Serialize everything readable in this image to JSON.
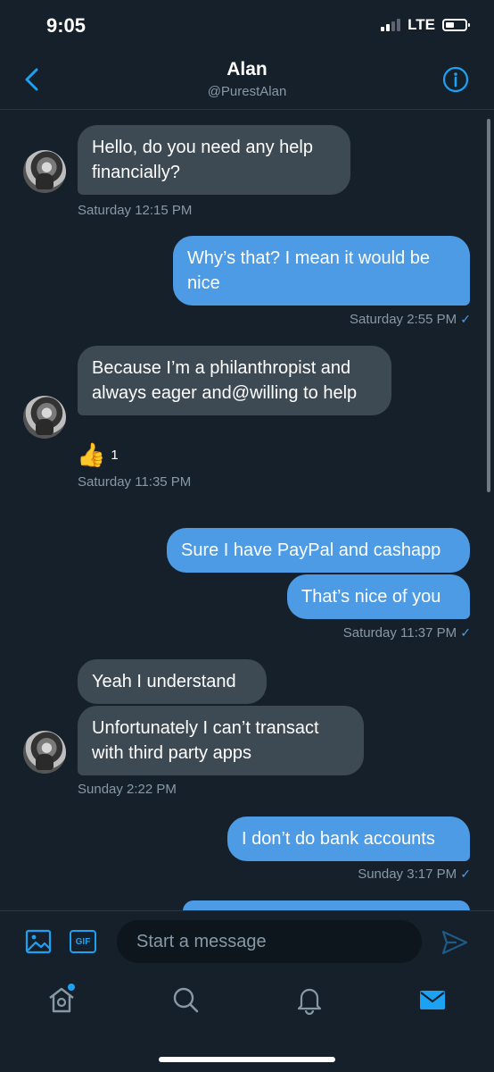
{
  "status_bar": {
    "time": "9:05",
    "network": "LTE"
  },
  "header": {
    "name": "Alan",
    "handle": "@PurestAlan"
  },
  "messages": {
    "m1": {
      "text": "Hello, do you need any help financially?",
      "time": "Saturday 12:15 PM"
    },
    "m2": {
      "text": "Why’s that? I mean it would be nice",
      "time": "Saturday 2:55 PM"
    },
    "m3": {
      "text": "Because I’m a philanthropist and always eager and@willing to help",
      "reaction_count": "1",
      "time": "Saturday 11:35 PM"
    },
    "m4": {
      "text": "Sure I have PayPal and cashapp"
    },
    "m5": {
      "text": "That’s nice of you",
      "time": "Saturday 11:37 PM"
    },
    "m6": {
      "text": "Yeah I  understand"
    },
    "m7": {
      "text": "Unfortunately I can’t transact with third party apps",
      "time": "Sunday 2:22 PM"
    },
    "m8": {
      "text": "I don’t do bank accounts",
      "time": "Sunday 3:17 PM"
    }
  },
  "composer": {
    "placeholder": "Start a message",
    "gif_label": "GIF"
  },
  "icons": {
    "back": "chevron-left-icon",
    "info": "info-icon",
    "image": "image-icon",
    "send": "send-icon",
    "tabs": [
      "home-icon",
      "search-icon",
      "bell-icon",
      "mail-icon"
    ]
  },
  "colors": {
    "background": "#15202b",
    "accent": "#1da1f2",
    "outgoing_bubble": "#4d9be5",
    "incoming_bubble": "#3d4953",
    "muted_text": "#8899a6"
  }
}
